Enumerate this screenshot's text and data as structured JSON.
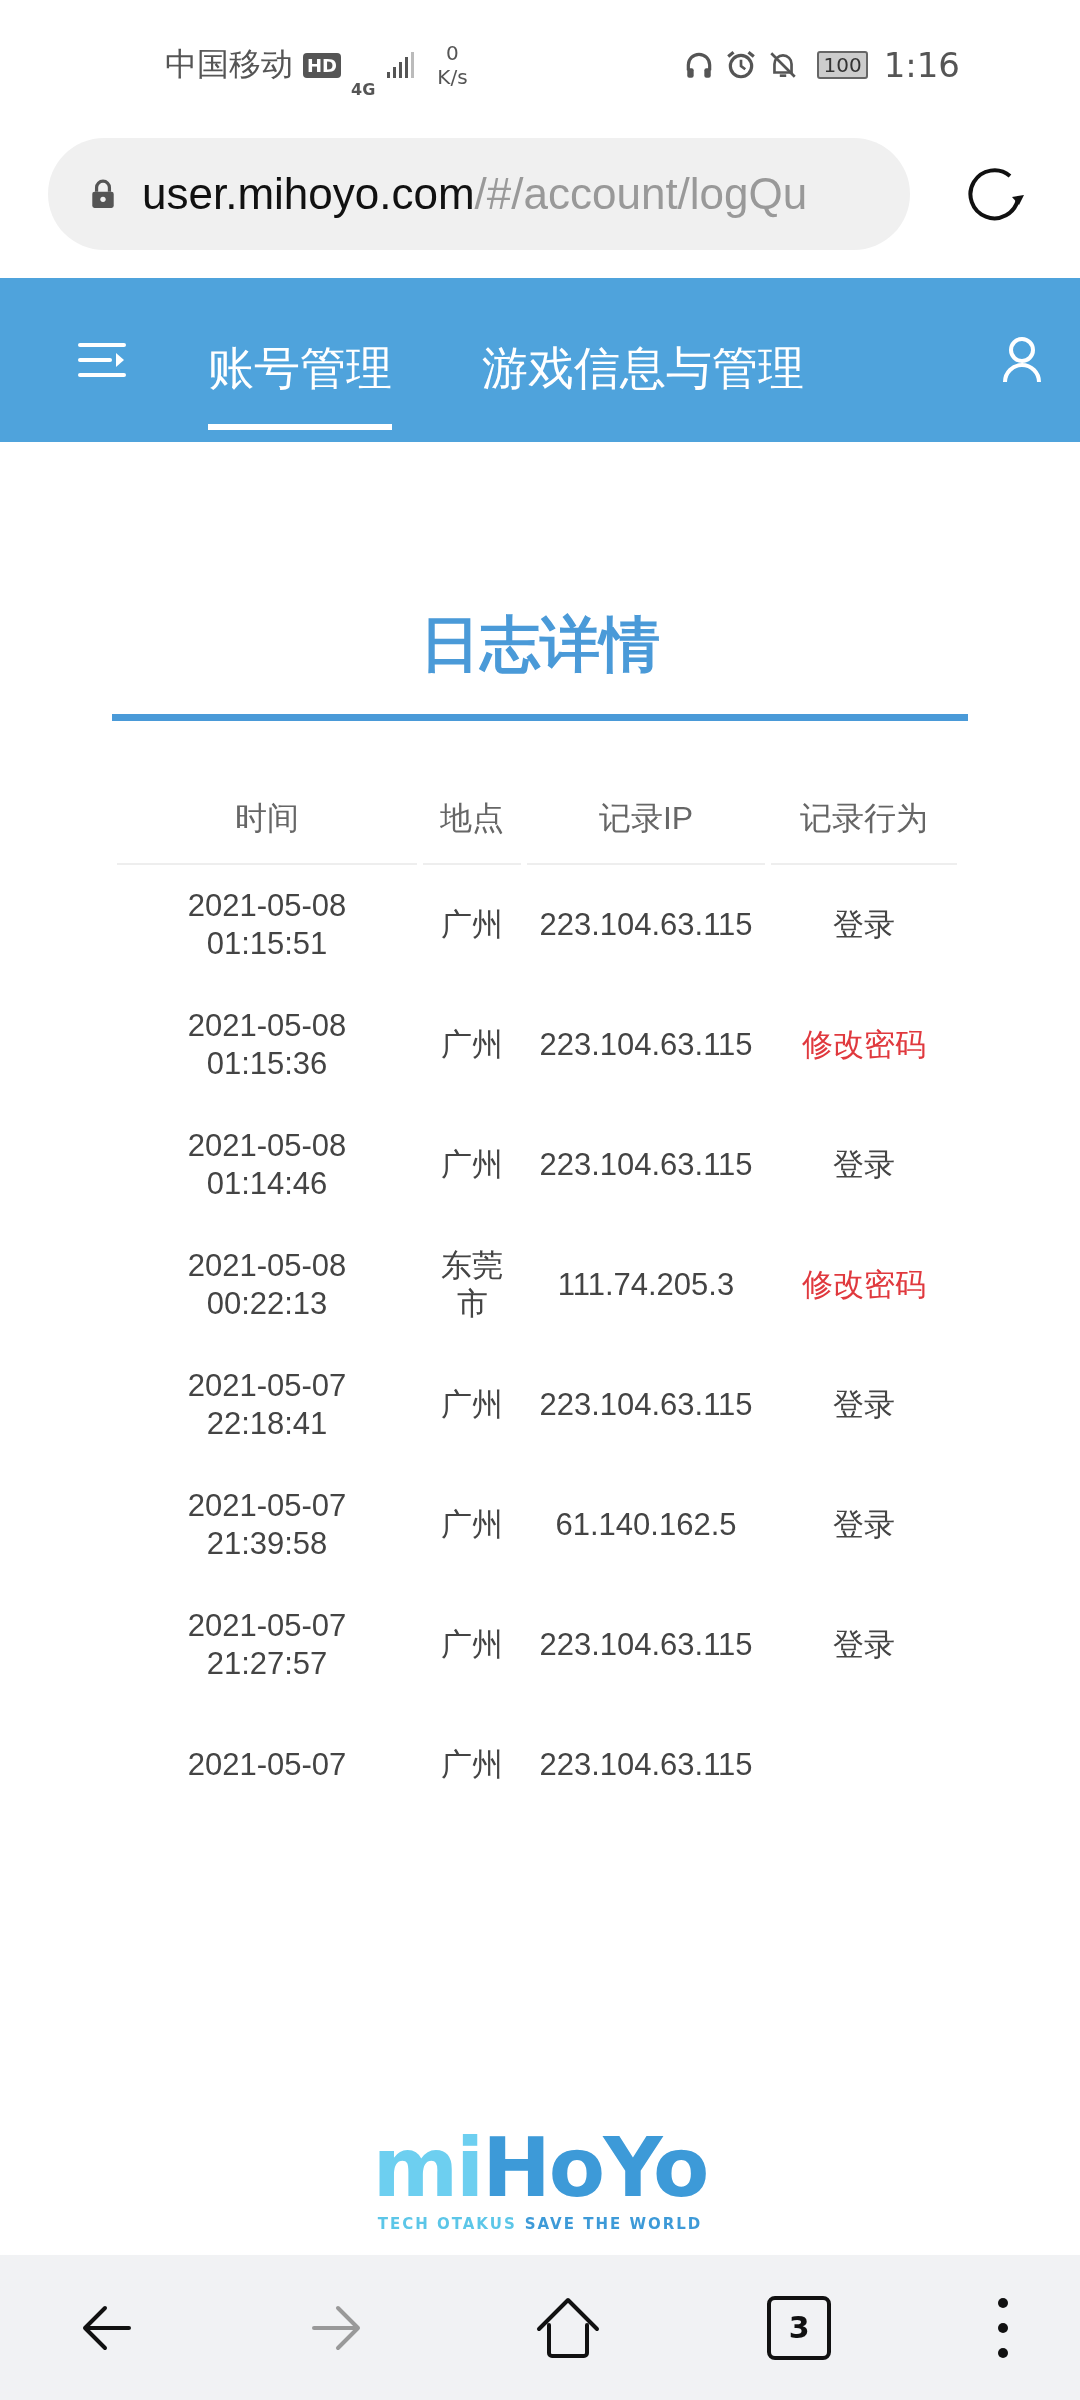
{
  "status_bar": {
    "carrier": "中国移动",
    "hd": "HD",
    "network": "4G",
    "speed_value": "0",
    "speed_unit": "K/s",
    "battery": "100",
    "time": "1:16"
  },
  "address_bar": {
    "host": "user.mihoyo.com",
    "path": "/#/account/logQu"
  },
  "nav": {
    "tabs": [
      {
        "label": "账号管理",
        "selected": true
      },
      {
        "label": "游戏信息与管理",
        "selected": false
      }
    ]
  },
  "page_title": "日志详情",
  "table": {
    "columns": [
      "时间",
      "地点",
      "记录IP",
      "记录行为"
    ],
    "rows": [
      {
        "time": "2021-05-08\n01:15:51",
        "place": "广州",
        "ip": "223.104.63.115",
        "action": "登录",
        "kind": "login"
      },
      {
        "time": "2021-05-08\n01:15:36",
        "place": "广州",
        "ip": "223.104.63.115",
        "action": "修改密码",
        "kind": "password"
      },
      {
        "time": "2021-05-08\n01:14:46",
        "place": "广州",
        "ip": "223.104.63.115",
        "action": "登录",
        "kind": "login"
      },
      {
        "time": "2021-05-08\n00:22:13",
        "place": "东莞市",
        "ip": "111.74.205.3",
        "action": "修改密码",
        "kind": "password"
      },
      {
        "time": "2021-05-07\n22:18:41",
        "place": "广州",
        "ip": "223.104.63.115",
        "action": "登录",
        "kind": "login"
      },
      {
        "time": "2021-05-07\n21:39:58",
        "place": "广州",
        "ip": "61.140.162.5",
        "action": "登录",
        "kind": "login"
      },
      {
        "time": "2021-05-07\n21:27:57",
        "place": "广州",
        "ip": "223.104.63.115",
        "action": "登录",
        "kind": "login"
      },
      {
        "time": "2021-05-07",
        "place": "广州",
        "ip": "223.104.63.115"
      }
    ]
  },
  "logo": {
    "wordmark": [
      "mi",
      "HoYo"
    ],
    "tagline": [
      "TECH OTAKUS",
      "SAVE THE WORLD"
    ]
  },
  "bottom_bar": {
    "tab_count": "3",
    "forward_disabled": true
  }
}
